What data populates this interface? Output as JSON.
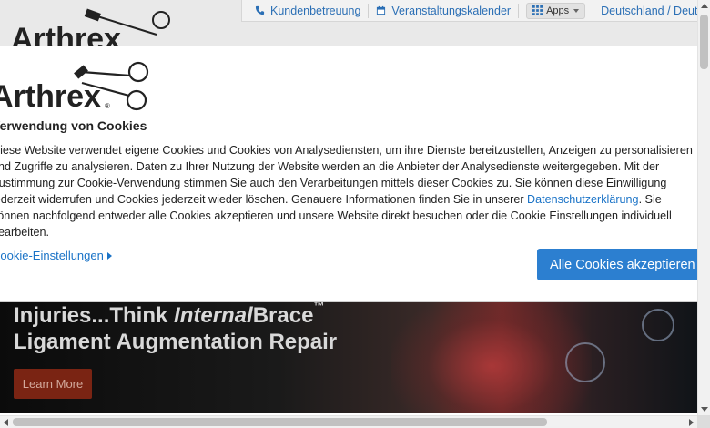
{
  "header": {
    "logo_text": "Arthrex",
    "utility_links": [
      {
        "label": "Kundenbetreuung",
        "icon": "phone-icon"
      },
      {
        "label": "Veranstaltungskalender",
        "icon": "calendar-icon"
      }
    ],
    "apps_label": "Apps",
    "region_label": "Deutschland / Deutsch"
  },
  "hero": {
    "line1_pre": "Injuries...Think ",
    "line1_em": "Internal",
    "line1_post": "Brace",
    "line1_tm": "™",
    "line2": "Ligament Augmentation Repair",
    "button_label": "Learn More"
  },
  "cookie_modal": {
    "logo_text": "Arthrex",
    "title": "Verwendung von Cookies",
    "body_lines": [
      "Diese Website verwendet eigene Cookies und Cookies von Analysediensten, um ihre Dienste bereitzustellen, Anzeigen zu personalisieren",
      "und Zugriffe zu analysieren. Daten zu Ihrer Nutzung der Website werden an die Anbieter der Analysedienste weitergegeben. Mit der",
      "Zustimmung zur Cookie-Verwendung stimmen Sie auch den Verarbeitungen mittels dieser Cookies zu. Sie können diese Einwilligung",
      "jederzeit widerrufen und Cookies jederzeit wieder löschen. Genauere Informationen finden Sie in unserer "
    ],
    "privacy_link": "Datenschutzerklärung",
    "line4_after": ". Sie",
    "body_lines_tail": [
      "können nachfolgend entweder alle Cookies akzeptieren und unsere Website direkt besuchen oder die Cookie Einstellungen individuell",
      "bearbeiten."
    ],
    "settings_link": "Cookie-Einstellungen",
    "accept_button": "Alle Cookies akzeptieren"
  },
  "colors": {
    "link": "#1a73c7",
    "accept_button": "#2c7fd0",
    "hero_button": "#7a2413",
    "header_link": "#2b6fb5"
  }
}
